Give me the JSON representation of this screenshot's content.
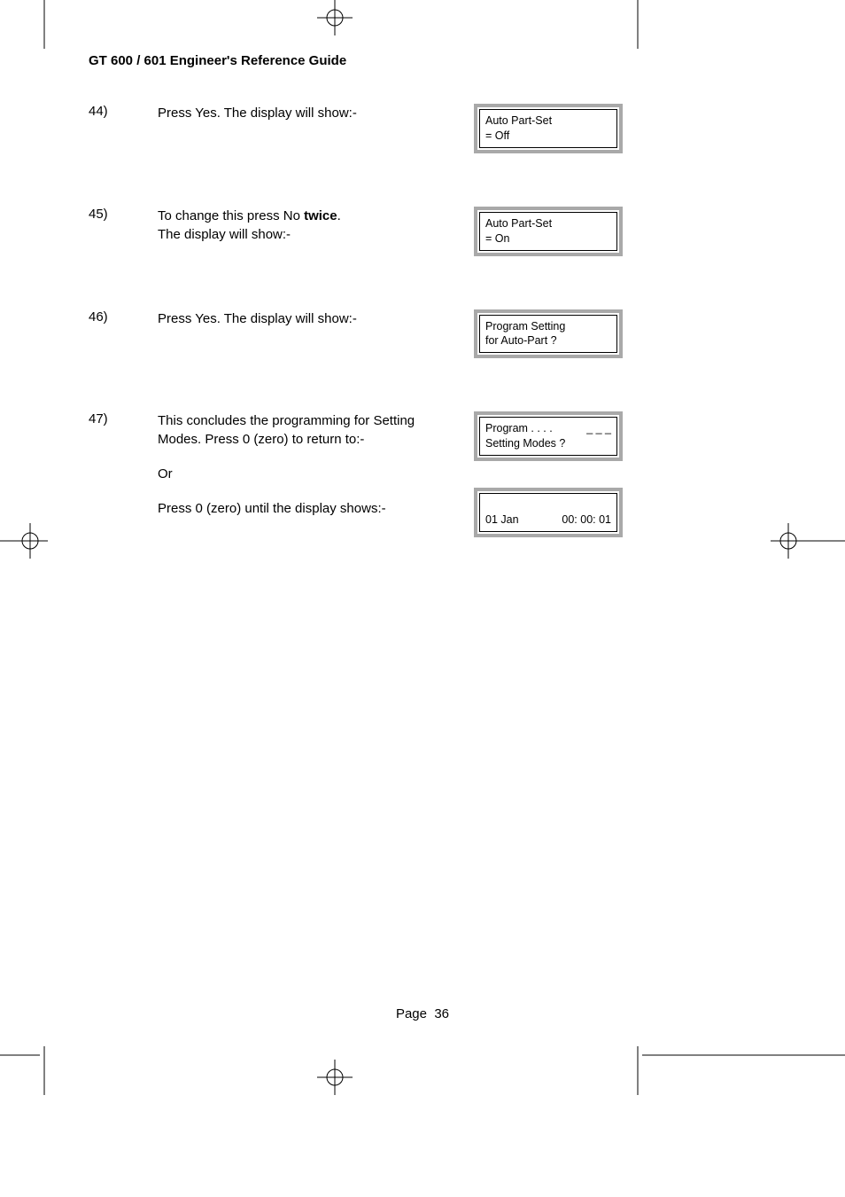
{
  "runningHead": "GT 600 / 601 Engineer's Reference Guide",
  "steps": [
    {
      "num": "44)",
      "text": "Press Yes. The display will show:-",
      "lcds": [
        {
          "line1": "Auto Part-Set",
          "line2": "= Off"
        }
      ]
    },
    {
      "num": "45)",
      "textPre": "To change this press No ",
      "textBold": "twice",
      "textPost": ".",
      "text2": "The display will show:-",
      "lcds": [
        {
          "line1": "Auto Part-Set",
          "line2": "= On"
        }
      ]
    },
    {
      "num": "46)",
      "text": "Press Yes. The display will show:-",
      "lcds": [
        {
          "line1": "Program Setting",
          "line2": "for Auto-Part  ?"
        }
      ]
    },
    {
      "num": "47)",
      "text": "This concludes the programming for Setting Modes. Press 0 (zero) to return to:-",
      "or": "Or",
      "text3": "Press 0 (zero) until the display shows:-",
      "lcds": [
        {
          "line1Left": "Program . . . .",
          "line1Right": "_ _ _",
          "line2": "Setting Modes ?"
        },
        {
          "line1Left": "01 Jan",
          "line1Right": "00: 00: 01",
          "blankTop": true
        }
      ]
    }
  ],
  "pageLabel": "Page",
  "pageNumber": "36"
}
